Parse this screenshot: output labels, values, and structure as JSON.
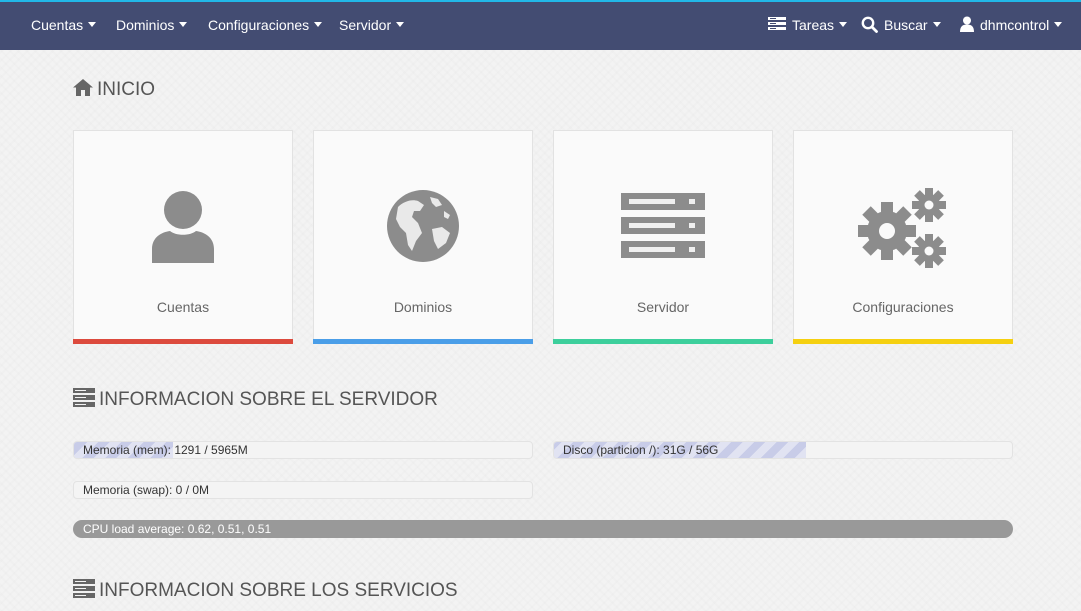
{
  "nav": {
    "left": [
      {
        "label": "Cuentas"
      },
      {
        "label": "Dominios"
      },
      {
        "label": "Configuraciones"
      },
      {
        "label": "Servidor"
      }
    ],
    "tasks_label": "Tareas",
    "search_label": "Buscar",
    "user_label": "dhmcontrol"
  },
  "home": {
    "title": "INICIO",
    "cards": [
      {
        "label": "Cuentas",
        "icon": "user-icon",
        "accent": "#dc4a3d"
      },
      {
        "label": "Dominios",
        "icon": "globe-icon",
        "accent": "#4a9ee8"
      },
      {
        "label": "Servidor",
        "icon": "server-icon",
        "accent": "#3dcf9c"
      },
      {
        "label": "Configuraciones",
        "icon": "gears-icon",
        "accent": "#f5d010"
      }
    ]
  },
  "server_info": {
    "title": "INFORMACION SOBRE EL SERVIDOR",
    "memory": {
      "label": "Memoria (mem): 1291 / 5965M",
      "fraction": 0.216
    },
    "disk": {
      "label": "Disco (particion /): 31G / 56G",
      "fraction": 0.55
    },
    "swap": {
      "label": "Memoria (swap): 0 / 0M",
      "fraction": 0
    },
    "cpu": {
      "label": "CPU load average: 0.62, 0.51, 0.51"
    }
  },
  "services_info": {
    "title": "INFORMACION SOBRE LOS SERVICIOS"
  },
  "colors": {
    "topbar": "#434c72",
    "topbar_accent": "#22b8e8",
    "icon_gray": "#8c8c8c"
  }
}
